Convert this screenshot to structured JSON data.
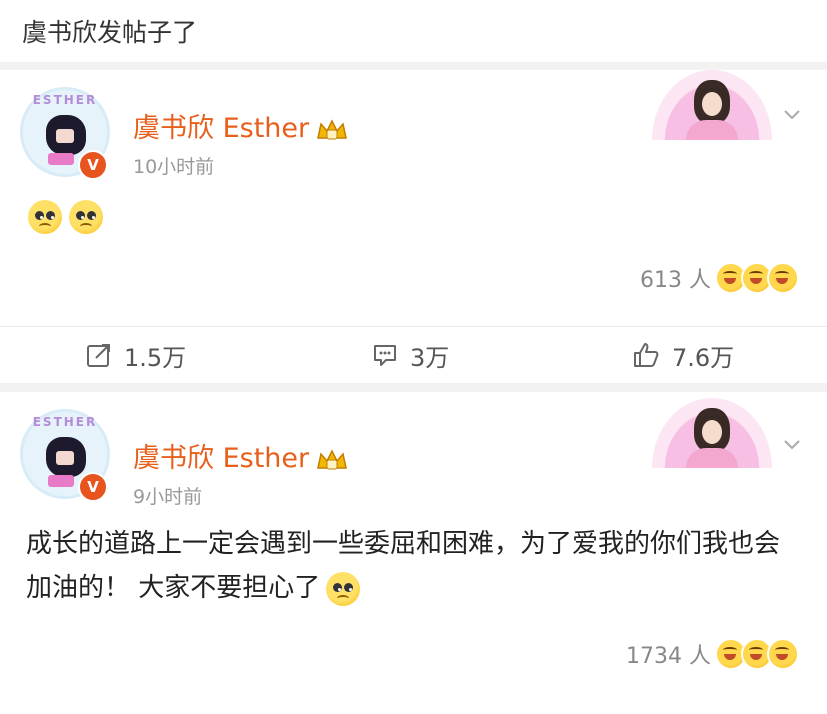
{
  "header": {
    "title": "虞书欣发帖子了"
  },
  "posts": [
    {
      "avatar_text": "ESTHER",
      "username": "虞书欣 Esther",
      "verified_mark": "V",
      "timestamp": "10小时前",
      "reaction_count": "613 人"
    },
    {
      "avatar_text": "ESTHER",
      "username": "虞书欣 Esther",
      "verified_mark": "V",
      "timestamp": "9小时前",
      "text": "成长的道路上一定会遇到一些委屈和困难，为了爱我的你们我也会加油的！ 大家不要担心了",
      "reaction_count": "1734 人"
    }
  ],
  "actions": {
    "repost": "1.5万",
    "comment": "3万",
    "like": "7.6万"
  },
  "icons": {
    "crown": "crown-badge-icon",
    "chevron": "chevron-down-icon",
    "repost": "repost-icon",
    "comment": "comment-icon",
    "like": "thumbs-up-icon",
    "verified": "verified-v-icon"
  },
  "colors": {
    "username": "#e85f1b",
    "verified": "#e8541e",
    "muted": "#999999"
  }
}
